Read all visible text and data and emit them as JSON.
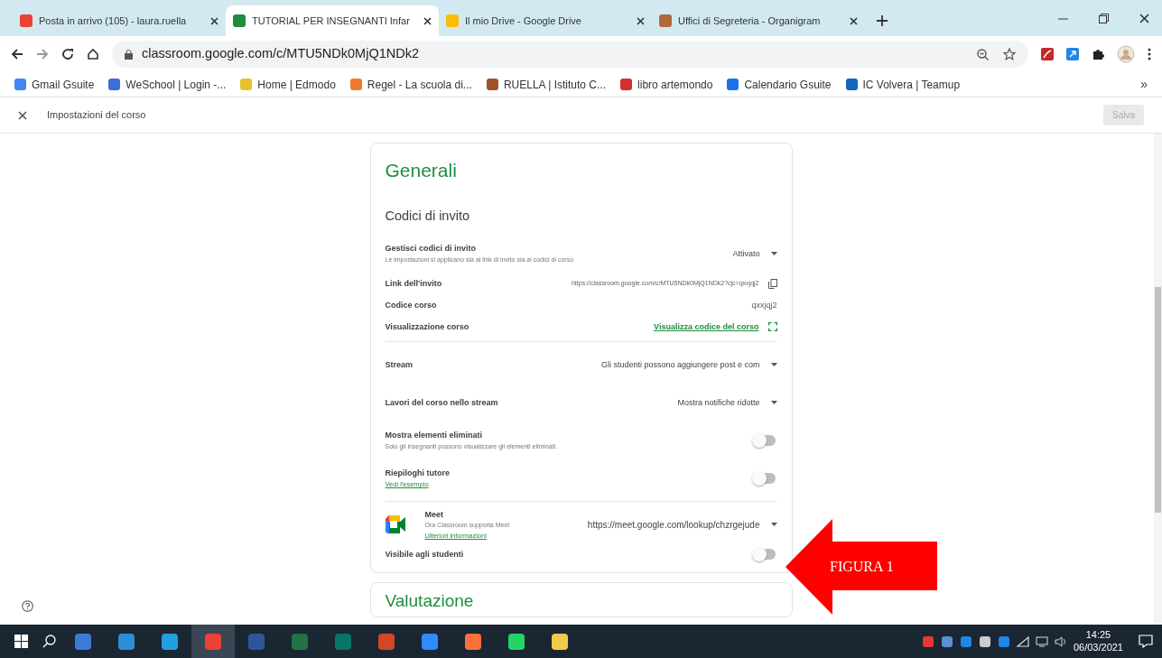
{
  "browser": {
    "tabs": [
      {
        "title": "Posta in arrivo (105) - laura.ruella",
        "selected": false,
        "color": "#ea4335"
      },
      {
        "title": "TUTORIAL PER INSEGNANTI Infar",
        "selected": true,
        "color": "#1e8e3e"
      },
      {
        "title": "Il mio Drive - Google Drive",
        "selected": false,
        "color": "#fbbc04"
      },
      {
        "title": "Uffici di Segreteria - Organigram",
        "selected": false,
        "color": "#b06a3b"
      }
    ],
    "address": "classroom.google.com/c/MTU5NDk0MjQ1NDk2",
    "bookmarks": [
      {
        "label": "Gmail Gsuite",
        "color": "#4285f4"
      },
      {
        "label": "WeSchool | Login -...",
        "color": "#3b6fd9"
      },
      {
        "label": "Home | Edmodo",
        "color": "#e6c229"
      },
      {
        "label": "Regel - La scuola di...",
        "color": "#f07a2b"
      },
      {
        "label": "RUELLA | Istituto C...",
        "color": "#a0522d"
      },
      {
        "label": "libro artemondo",
        "color": "#d32f2f"
      },
      {
        "label": "Calendario Gsuite",
        "color": "#1a73e8"
      },
      {
        "label": "IC Volvera | Teamup",
        "color": "#1565c0"
      }
    ],
    "bookmarks_overflow": "»"
  },
  "header": {
    "title": "Impostazioni del corso",
    "save": {
      "label": "Salva",
      "disabled": true
    }
  },
  "card": {
    "title": "Generali",
    "section": "Codici di invito",
    "rows": [
      {
        "kind": "dropdown",
        "label": "Gestisci codici di invito",
        "subtitle": "Le impostazioni si applicano sia ai link di invito sia ai codici di corso",
        "value": "Attivato"
      },
      {
        "kind": "copy",
        "label": "Link dell'invito",
        "value": "https://classroom.google.com/c/MTU5NDk0MjQ1NDk2?cjc=qxxjqj2"
      },
      {
        "kind": "value",
        "label": "Codice corso",
        "value": "qxxjqj2"
      },
      {
        "kind": "link",
        "label": "Visualizzazione corso",
        "value": "Visualizza codice del corso"
      },
      {
        "kind": "divider"
      },
      {
        "kind": "dropdown",
        "label": "Stream",
        "value": "Gli studenti possono aggiungere post e com"
      },
      {
        "kind": "dropdown",
        "label": "Lavori del corso nello stream",
        "value": "Mostra notifiche ridotte"
      },
      {
        "kind": "toggle",
        "label": "Mostra elementi eliminati",
        "subtitle": "Solo gli insegnanti possono visualizzare gli elementi eliminati.",
        "on": false
      },
      {
        "kind": "toggle",
        "label": "Riepiloghi tutore",
        "subtitle_link": "Vedi l'esempio",
        "on": false
      },
      {
        "kind": "divider"
      },
      {
        "kind": "meet",
        "label": "Meet",
        "subtitle": "Ora Classroom supporta Meet",
        "subtitle_link": "Ulteriori informazioni",
        "value": "https://meet.google.com/lookup/chzrgejude"
      },
      {
        "kind": "toggle",
        "label": "Visibile agli studenti",
        "on": false
      }
    ]
  },
  "next_card": {
    "title": "Valutazione"
  },
  "annotation": {
    "label": "FIGURA 1"
  },
  "taskbar": {
    "apps": [
      {
        "color": "#3a7bd5",
        "selected": false
      },
      {
        "color": "#2b8fd6",
        "selected": false
      },
      {
        "color": "#1fa0e0",
        "selected": false
      },
      {
        "color": "#ea4335",
        "selected": true
      },
      {
        "color": "#2b579a",
        "selected": false
      },
      {
        "color": "#217346",
        "selected": false
      },
      {
        "color": "#077568",
        "selected": false
      },
      {
        "color": "#d24726",
        "selected": false
      },
      {
        "color": "#2d8cff",
        "selected": false
      },
      {
        "color": "#ff7139",
        "selected": false
      },
      {
        "color": "#25d366",
        "selected": false
      },
      {
        "color": "#f2c94c",
        "selected": false
      }
    ],
    "time": "14:25",
    "date": "06/03/2021"
  }
}
